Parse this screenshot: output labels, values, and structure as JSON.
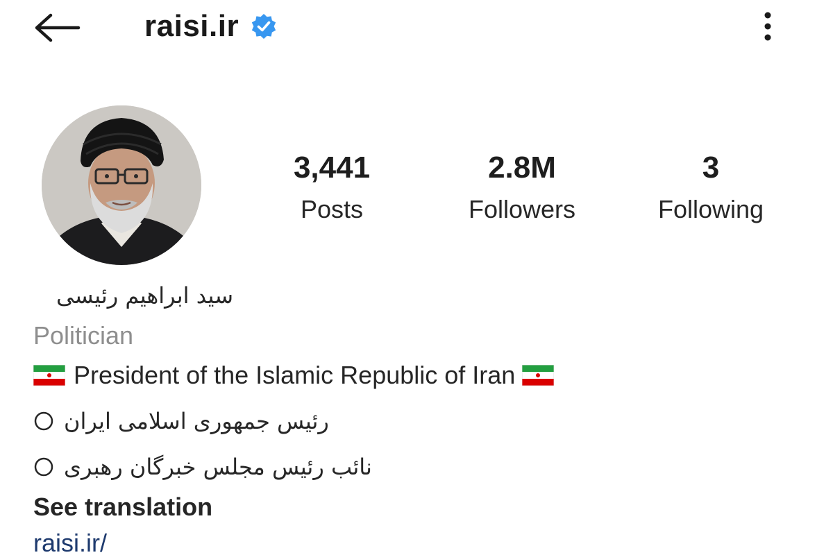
{
  "header": {
    "username": "raisi.ir",
    "verified_color": "#3897f0"
  },
  "stats": {
    "posts": {
      "value": "3,441",
      "label": "Posts"
    },
    "followers": {
      "value": "2.8M",
      "label": "Followers"
    },
    "following": {
      "value": "3",
      "label": "Following"
    }
  },
  "bio": {
    "full_name": "سید ابراهیم رئیسی",
    "category": "Politician",
    "line1": "President of the Islamic Republic of Iran",
    "line2": "رئیس جمهوری اسلامی ایران",
    "line3": "نائب رئیس مجلس خبرگان رهبری",
    "see_translation": "See translation",
    "website": "raisi.ir/"
  },
  "icons": {
    "back": "back-arrow-icon",
    "verified": "verified-badge-icon",
    "more": "more-options-icon",
    "flag": "iran-flag-icon",
    "bullet": "circle-icon"
  }
}
